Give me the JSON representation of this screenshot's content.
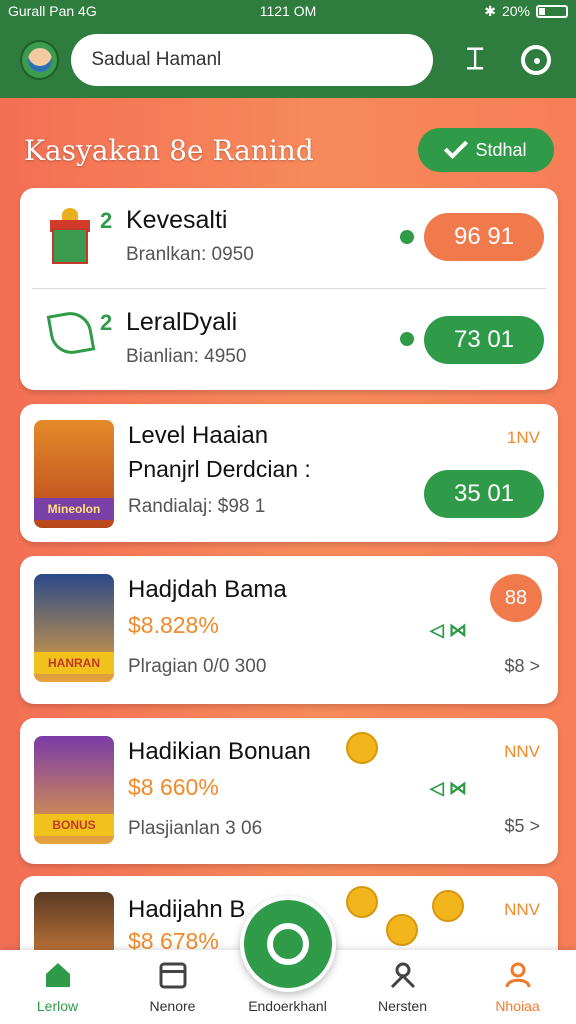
{
  "status_bar": {
    "carrier": "Gurall Pan 4G",
    "time": "1121 OM",
    "battery": "20%"
  },
  "header": {
    "search_value": "Sadual Hamanl"
  },
  "section": {
    "title": "Kasyakan 8e Ranind",
    "status_button": "Stdhal"
  },
  "levels": [
    {
      "num": "2",
      "name": "Kevesalti",
      "sub": "Branlkan: 0950",
      "value": "96 91"
    },
    {
      "num": "2",
      "name": "LeralDyali",
      "sub": "Bianlian: 4950",
      "value": "73 01"
    }
  ],
  "promos": [
    {
      "title": "Level Haaian",
      "subtitle": "Pnanjrl Derdcian :",
      "meta": "Randialaj: $98 1",
      "right": "1NV",
      "value": "35 01",
      "tag": "Mineolon"
    },
    {
      "title": "Hadjdah Bama",
      "amount": "$8.828%",
      "meta": "Plragian 0/0 300",
      "badge": "88",
      "link": "$8 >",
      "tag": "HANRAN"
    },
    {
      "title": "Hadikian Bonuan",
      "amount": "$8 660%",
      "meta": "Plasjianlan 3 06",
      "right": "NNV",
      "link": "$5 >",
      "tag": "BONUS"
    },
    {
      "title": "Hadijahn B",
      "amount": "$8 678%",
      "right": "NNV"
    }
  ],
  "bottom_nav": [
    {
      "label": "Lerlow",
      "icon": "home-icon"
    },
    {
      "label": "Nenore",
      "icon": "store-icon"
    },
    {
      "label": "Endoerkhanl",
      "icon": "gear-icon"
    },
    {
      "label": "Nersten",
      "icon": "network-icon"
    },
    {
      "label": "Nhoiaa",
      "icon": "profile-icon"
    }
  ]
}
